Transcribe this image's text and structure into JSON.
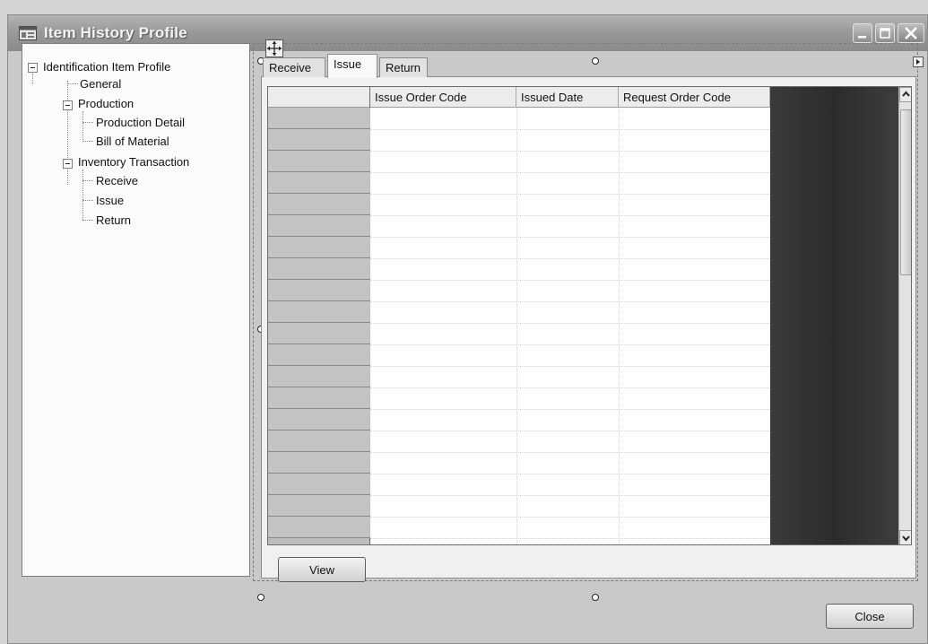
{
  "window": {
    "title": "Item History Profile"
  },
  "tree": {
    "root_label": "Identification Item Profile",
    "items": [
      {
        "label": "General"
      },
      {
        "label": "Production"
      },
      {
        "label": "Production Detail"
      },
      {
        "label": "Bill of Material"
      },
      {
        "label": "Inventory Transaction"
      },
      {
        "label": "Receive"
      },
      {
        "label": "Issue"
      },
      {
        "label": "Return"
      }
    ]
  },
  "tabs": [
    {
      "label": "Receive",
      "active": false
    },
    {
      "label": "Issue",
      "active": true
    },
    {
      "label": "Return",
      "active": false
    }
  ],
  "grid": {
    "columns": [
      "Issue Order Code",
      "Issued Date",
      "Request Order Code"
    ],
    "row_count": 20
  },
  "buttons": {
    "view_label": "View",
    "close_label": "Close"
  },
  "icons": {
    "window": "app-window-icon",
    "minimize": "minimize-icon",
    "maximize": "maximize-icon",
    "close": "close-icon",
    "move": "move-handle-icon",
    "scroll_up": "chevron-up-icon",
    "scroll_down": "chevron-down-icon"
  }
}
